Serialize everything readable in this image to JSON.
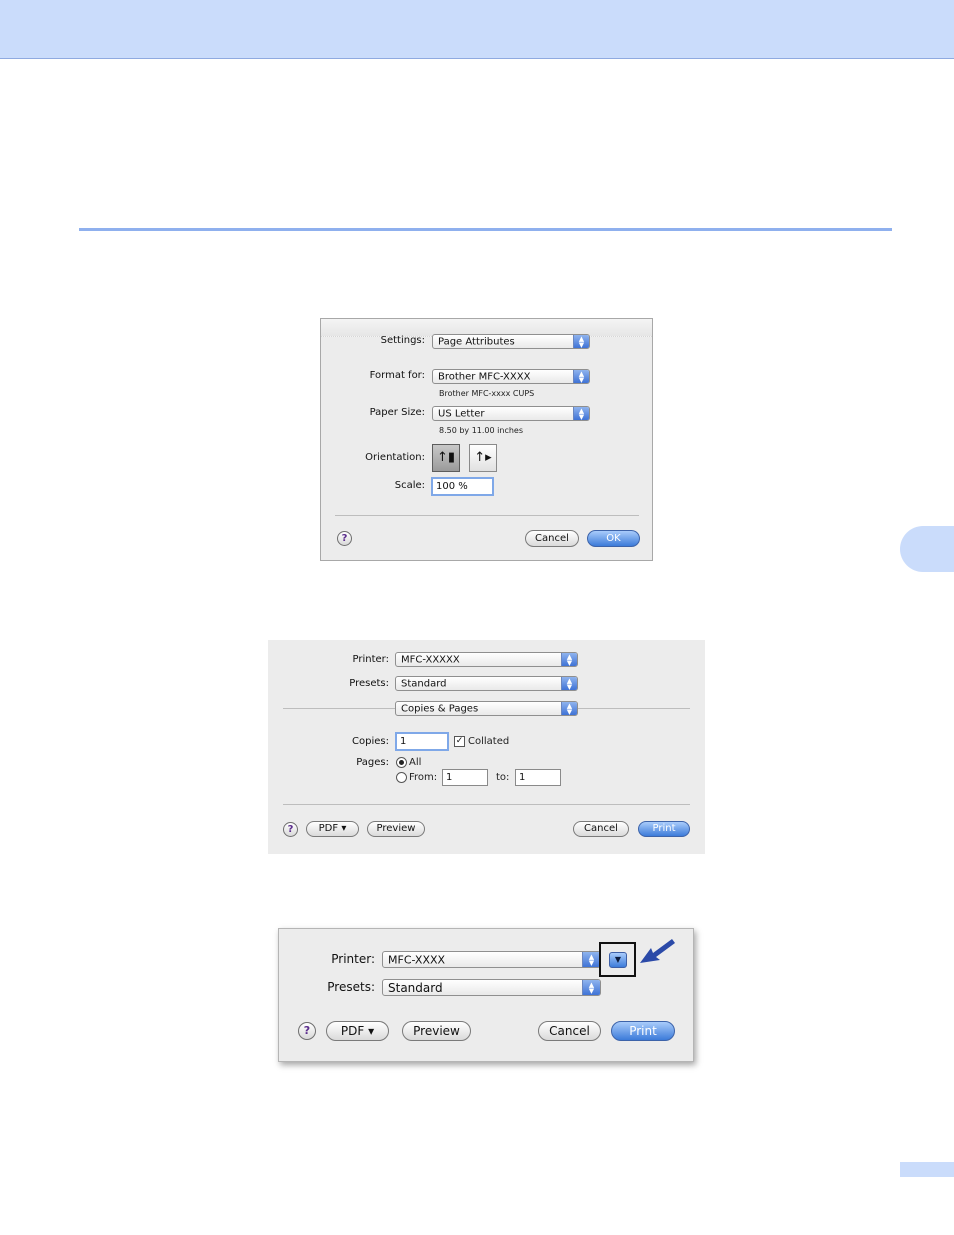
{
  "page_setup_dialog": {
    "settings_label": "Settings:",
    "settings_value": "Page Attributes",
    "format_for_label": "Format for:",
    "format_for_value": "Brother MFC-XXXX",
    "format_for_note": "Brother MFC-xxxx CUPS",
    "paper_size_label": "Paper Size:",
    "paper_size_value": "US Letter",
    "paper_size_note": "8.50 by 11.00 inches",
    "orientation_label": "Orientation:",
    "scale_label": "Scale:",
    "scale_value": "100 %",
    "help_label": "?",
    "cancel_label": "Cancel",
    "ok_label": "OK"
  },
  "print_dialog_expanded": {
    "printer_label": "Printer:",
    "printer_value": "MFC-XXXXX",
    "presets_label": "Presets:",
    "presets_value": "Standard",
    "panel_value": "Copies & Pages",
    "copies_label": "Copies:",
    "copies_value": "1",
    "collated_label": "Collated",
    "pages_label": "Pages:",
    "all_label": "All",
    "from_label": "From:",
    "from_value": "1",
    "to_label": "to:",
    "to_value": "1",
    "help_label": "?",
    "pdf_label": "PDF ▾",
    "preview_label": "Preview",
    "cancel_label": "Cancel",
    "print_label": "Print"
  },
  "print_dialog_collapsed": {
    "printer_label": "Printer:",
    "printer_value": "MFC-XXXX",
    "presets_label": "Presets:",
    "presets_value": "Standard",
    "help_label": "?",
    "pdf_label": "PDF ▾",
    "preview_label": "Preview",
    "cancel_label": "Cancel",
    "print_label": "Print"
  },
  "colors": {
    "header_band": "#cadcfb",
    "section_rule": "#8fb0ee",
    "arrow": "#2b4aa8",
    "default_button": "#3c7bd9"
  }
}
